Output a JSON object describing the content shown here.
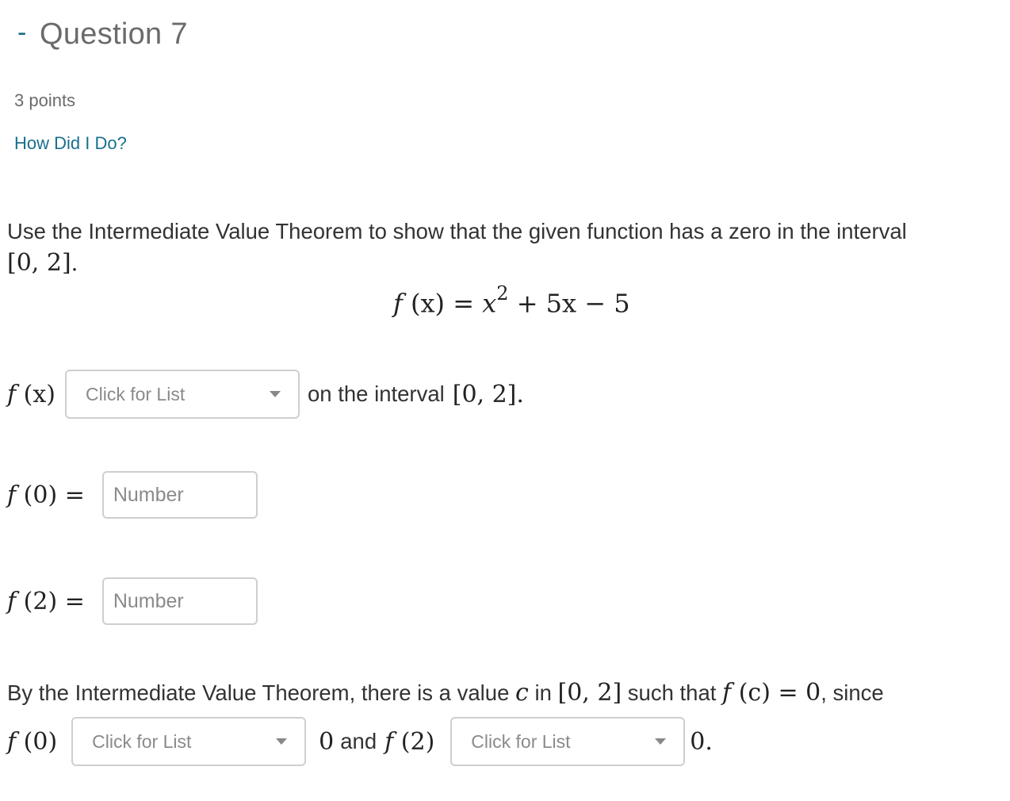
{
  "header": {
    "collapse_symbol": "-",
    "title": "Question 7",
    "points": "3 points",
    "feedback_link": "How Did I Do?"
  },
  "colors": {
    "link": "#1a6e8e",
    "title_gray": "#6b6b6b",
    "border": "#cfcfcf",
    "placeholder": "#8a8a8a"
  },
  "prompt": {
    "text": "Use the Intermediate Value Theorem to show that the given function has a zero in the interval",
    "interval": "[0, 2]",
    "end": "."
  },
  "formula": {
    "lhs_fn": "f",
    "lhs_arg": "(x)",
    "eq": "=",
    "var": "x",
    "exp": "2",
    "rest": "+ 5x − 5"
  },
  "line1": {
    "fn": "f",
    "arg": "(x)",
    "select_placeholder": "Click for List",
    "suffix_text": "on the interval",
    "interval": "[0, 2]",
    "end": "."
  },
  "line2": {
    "fn": "f",
    "arg": "(0)",
    "eq": "=",
    "input_placeholder": "Number",
    "input_value": ""
  },
  "line3": {
    "fn": "f",
    "arg": "(2)",
    "eq": "=",
    "input_placeholder": "Number",
    "input_value": ""
  },
  "conclusion": {
    "text1": "By the Intermediate Value Theorem, there is a value",
    "c": "c",
    "text2": "in",
    "interval": "[0, 2]",
    "text3": "such that",
    "fc_fn": "f",
    "fc_arg": "(c)",
    "fc_eq": "= 0",
    "text4": ", since",
    "f0_fn": "f",
    "f0_arg": "(0)",
    "select1_placeholder": "Click for List",
    "mid_zero": "0",
    "and_text": "and",
    "f2_fn": "f",
    "f2_arg": "(2)",
    "select2_placeholder": "Click for List",
    "end_zero": "0."
  }
}
